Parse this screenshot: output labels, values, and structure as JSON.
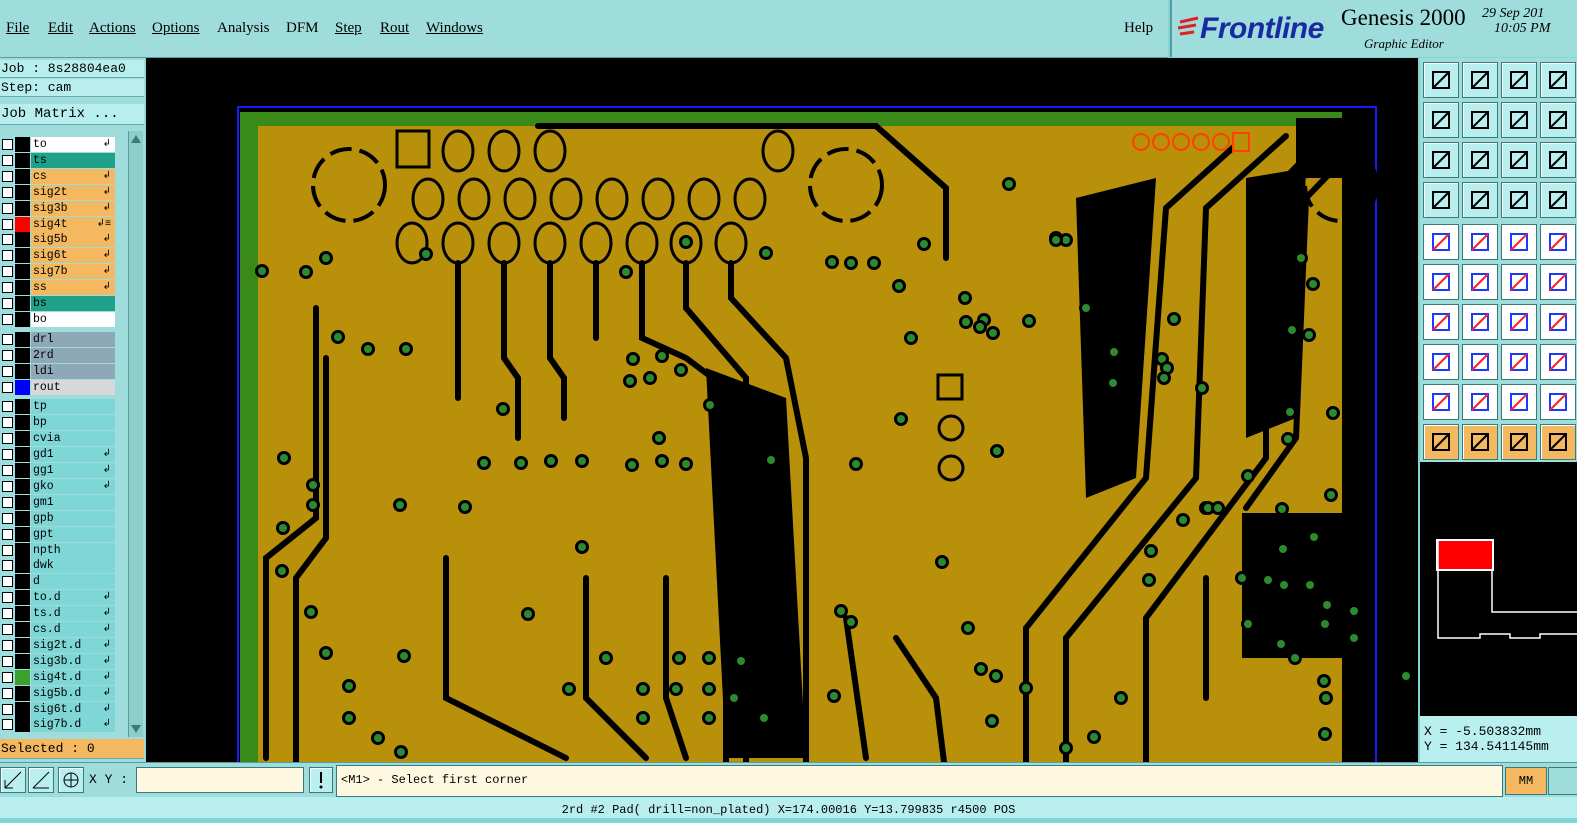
{
  "menus": [
    {
      "label": "File"
    },
    {
      "label": "Edit"
    },
    {
      "label": "Actions"
    },
    {
      "label": "Options"
    },
    {
      "label": "Analysis"
    },
    {
      "label": "DFM"
    },
    {
      "label": "Step"
    },
    {
      "label": "Rout"
    },
    {
      "label": "Windows"
    }
  ],
  "help_label": "Help",
  "brand": {
    "logo": "Frontline",
    "product": "Genesis 2000",
    "subtitle": "Graphic Editor",
    "date": "29 Sep 201",
    "time": "10:05 PM"
  },
  "job": {
    "job_line": "Job : 8s28804ea0",
    "step_line": "Step: cam",
    "matrix_button": "Job Matrix ..."
  },
  "layers": [
    {
      "name": "to",
      "color": "#000000",
      "bg": "#ffffff",
      "arrow": "↲"
    },
    {
      "name": "ts",
      "color": "#000000",
      "bg": "#1fa088",
      "arrow": ""
    },
    {
      "name": "cs",
      "color": "#000000",
      "bg": "#f4b860",
      "arrow": "↲"
    },
    {
      "name": "sig2t",
      "color": "#000000",
      "bg": "#f4b860",
      "arrow": "↲"
    },
    {
      "name": "sig3b",
      "color": "#000000",
      "bg": "#f4b860",
      "arrow": "↲"
    },
    {
      "name": "sig4t",
      "color": "#ff0000",
      "bg": "#f4b860",
      "arrow": "↲≡"
    },
    {
      "name": "sig5b",
      "color": "#000000",
      "bg": "#f4b860",
      "arrow": "↲"
    },
    {
      "name": "sig6t",
      "color": "#000000",
      "bg": "#f4b860",
      "arrow": "↲"
    },
    {
      "name": "sig7b",
      "color": "#000000",
      "bg": "#f4b860",
      "arrow": "↲"
    },
    {
      "name": "ss",
      "color": "#000000",
      "bg": "#f4b860",
      "arrow": "↲"
    },
    {
      "name": "bs",
      "color": "#000000",
      "bg": "#1fa088",
      "arrow": ""
    },
    {
      "name": "bo",
      "color": "#000000",
      "bg": "#ffffff",
      "arrow": ""
    },
    {
      "name": "drl",
      "color": "#000000",
      "bg": "#8fa8b8",
      "arrow": ""
    },
    {
      "name": "2rd",
      "color": "#000000",
      "bg": "#8fa8b8",
      "arrow": ""
    },
    {
      "name": "ldi",
      "color": "#000000",
      "bg": "#8fa8b8",
      "arrow": ""
    },
    {
      "name": "rout",
      "color": "#0000ff",
      "bg": "#d8d8d8",
      "arrow": ""
    },
    {
      "name": "tp",
      "color": "#000000",
      "bg": "#7fd6d6",
      "arrow": ""
    },
    {
      "name": "bp",
      "color": "#000000",
      "bg": "#7fd6d6",
      "arrow": ""
    },
    {
      "name": "cvia",
      "color": "#000000",
      "bg": "#7fd6d6",
      "arrow": ""
    },
    {
      "name": "gd1",
      "color": "#000000",
      "bg": "#7fd6d6",
      "arrow": "↲"
    },
    {
      "name": "gg1",
      "color": "#000000",
      "bg": "#7fd6d6",
      "arrow": "↲"
    },
    {
      "name": "gko",
      "color": "#000000",
      "bg": "#7fd6d6",
      "arrow": "↲"
    },
    {
      "name": "gm1",
      "color": "#000000",
      "bg": "#7fd6d6",
      "arrow": ""
    },
    {
      "name": "gpb",
      "color": "#000000",
      "bg": "#7fd6d6",
      "arrow": ""
    },
    {
      "name": "gpt",
      "color": "#000000",
      "bg": "#7fd6d6",
      "arrow": ""
    },
    {
      "name": "npth",
      "color": "#000000",
      "bg": "#7fd6d6",
      "arrow": ""
    },
    {
      "name": "dwk",
      "color": "#000000",
      "bg": "#7fd6d6",
      "arrow": ""
    },
    {
      "name": "d",
      "color": "#000000",
      "bg": "#7fd6d6",
      "arrow": ""
    },
    {
      "name": "to.d",
      "color": "#000000",
      "bg": "#7fd6d6",
      "arrow": "↲"
    },
    {
      "name": "ts.d",
      "color": "#000000",
      "bg": "#7fd6d6",
      "arrow": "↲"
    },
    {
      "name": "cs.d",
      "color": "#000000",
      "bg": "#7fd6d6",
      "arrow": "↲"
    },
    {
      "name": "sig2t.d",
      "color": "#000000",
      "bg": "#7fd6d6",
      "arrow": "↲"
    },
    {
      "name": "sig3b.d",
      "color": "#000000",
      "bg": "#7fd6d6",
      "arrow": "↲"
    },
    {
      "name": "sig4t.d",
      "color": "#3aa030",
      "bg": "#7fd6d6",
      "arrow": "↲"
    },
    {
      "name": "sig5b.d",
      "color": "#000000",
      "bg": "#7fd6d6",
      "arrow": "↲"
    },
    {
      "name": "sig6t.d",
      "color": "#000000",
      "bg": "#7fd6d6",
      "arrow": "↲"
    },
    {
      "name": "sig7b.d",
      "color": "#000000",
      "bg": "#7fd6d6",
      "arrow": "↲"
    }
  ],
  "selected": "Selected : 0",
  "coords": {
    "x": "X = -5.503832mm",
    "y": "Y = 134.541145mm"
  },
  "xy_label": "X Y :",
  "xy_value": "",
  "prompt": "<M1> - Select first corner",
  "units": "MM",
  "status": "2rd #2 Pad( drill=non_plated) X=174.00016 Y=13.799835 r4500 POS",
  "colors": {
    "copper": "#b8900a",
    "board_green": "#3a8a1a",
    "via": "#2e8a2e",
    "trace": "#000000",
    "outline": "#1a1aff"
  }
}
